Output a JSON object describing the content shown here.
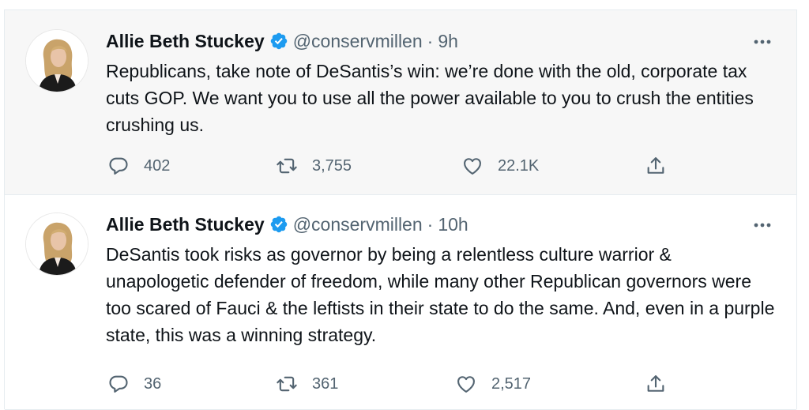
{
  "tweets": [
    {
      "author_name": "Allie Beth Stuckey",
      "handle": "@conservmillen",
      "separator": "·",
      "time": "9h",
      "text": "Republicans, take note of DeSantis’s win: we’re done with the old, corporate tax cuts GOP. We want you to use all the power available to you to crush the entities crushing us.",
      "replies": "402",
      "retweets": "3,755",
      "likes": "22.1K"
    },
    {
      "author_name": "Allie Beth Stuckey",
      "handle": "@conservmillen",
      "separator": "·",
      "time": "10h",
      "text": "DeSantis took risks as governor by being a relentless culture warrior & unapologetic defender of freedom, while many other Republican governors were too scared of Fauci & the leftists in their state to do the same. And, even in a purple state, this was a winning strategy.",
      "replies": "36",
      "retweets": "361",
      "likes": "2,517"
    }
  ],
  "icons": {
    "reply": "reply-icon",
    "retweet": "retweet-icon",
    "like": "heart-icon",
    "share": "share-icon",
    "more": "more-options-icon",
    "verified": "verified-badge-icon"
  },
  "colors": {
    "verified": "#1d9bf0",
    "secondary_text": "#536471",
    "highlight_bg": "#f7f7f7"
  }
}
